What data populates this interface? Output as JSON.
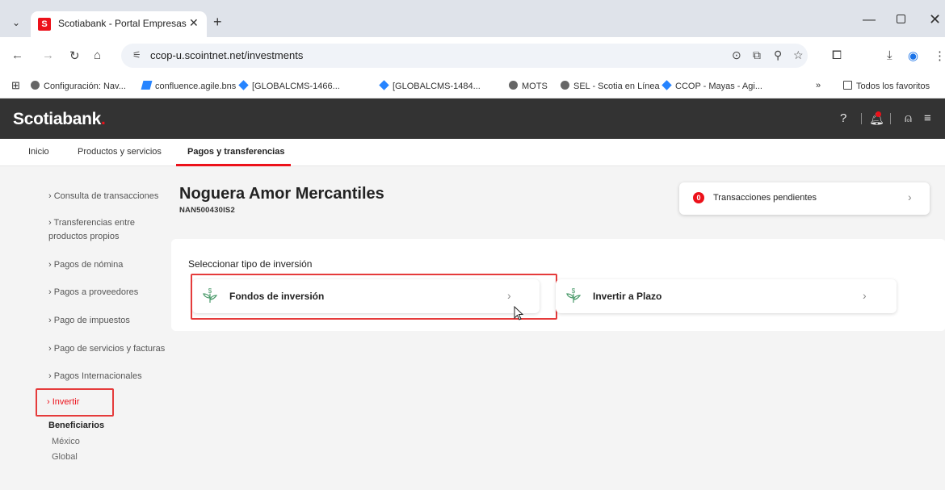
{
  "browser": {
    "tab_title": "Scotiabank - Portal Empresas",
    "tab_favicon_letter": "S",
    "url": "ccop-u.scointnet.net/investments",
    "bookmarks": [
      {
        "label": "Configuración: Nav...",
        "icon": "gear-icon"
      },
      {
        "label": "confluence.agile.bns",
        "icon": "confluence-icon"
      },
      {
        "label": "[GLOBALCMS-1466...",
        "icon": "diamond-icon"
      },
      {
        "label": "[GLOBALCMS-1484...",
        "icon": "diamond-icon"
      },
      {
        "label": "MOTS",
        "icon": "globe-icon"
      },
      {
        "label": "SEL - Scotia en Línea",
        "icon": "globe-icon"
      },
      {
        "label": "CCOP - Mayas - Agi...",
        "icon": "diamond-icon"
      }
    ],
    "bookmarks_more": "»",
    "all_bookmarks": "Todos los favoritos"
  },
  "header": {
    "brand": "Scotiabank",
    "brand_dot": ".",
    "notification_badge": "0"
  },
  "topnav": {
    "items": [
      "Inicio",
      "Productos y servicios",
      "Pagos y transferencias"
    ],
    "active": "Pagos y transferencias"
  },
  "sidebar": {
    "items": [
      "Consulta de transacciones",
      "Transferencias entre",
      "productos propios",
      "Pagos de nómina",
      "Pagos a proveedores",
      "Pago de impuestos",
      "Pago de servicios y facturas",
      "Pagos Internacionales"
    ],
    "active_item": "Invertir",
    "beneficiarios": {
      "heading": "Beneficiarios",
      "items": [
        "México",
        "Global"
      ]
    }
  },
  "main": {
    "company_name": "Noguera Amor Mercantiles",
    "company_id": "NAN500430IS2",
    "pending": {
      "count": "0",
      "label": "Transacciones pendientes"
    },
    "investment": {
      "title": "Seleccionar tipo de inversión",
      "options": [
        "Fondos de inversión",
        "Invertir a Plazo"
      ]
    }
  },
  "colors": {
    "brand_red": "#ec111a",
    "header_dark": "#333333",
    "highlight_red": "#e53b3b",
    "icon_green": "#4a9a6a"
  }
}
